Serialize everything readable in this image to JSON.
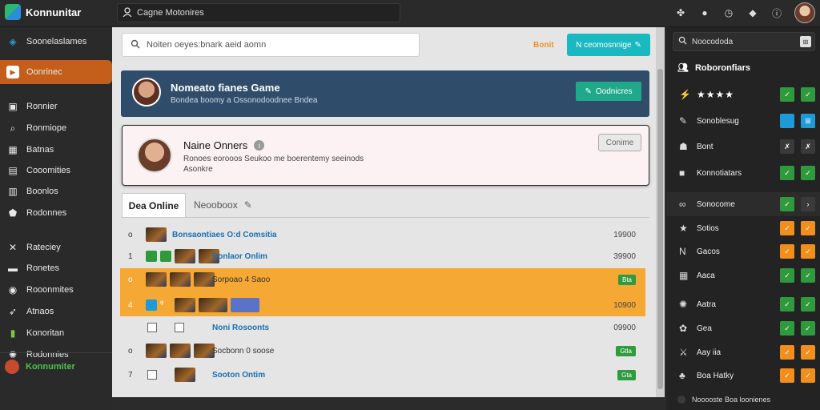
{
  "app": {
    "title": "Konnunitar",
    "search_placeholder": "Cagne Motonires"
  },
  "top_icons": [
    "puzzle-icon",
    "chat-icon",
    "clock-icon",
    "tag-icon",
    "info-icon"
  ],
  "sidebar": {
    "active": {
      "label": "Oonrinec",
      "icon": "play-icon"
    },
    "header": {
      "label": "Soonelaslames",
      "icon": "cube-icon"
    },
    "items": [
      {
        "label": "Ronnier",
        "icon": "briefcase-icon"
      },
      {
        "label": "Ronmiope",
        "icon": "search-icon"
      },
      {
        "label": "Batnas",
        "icon": "calendar-icon"
      },
      {
        "label": "Cooomities",
        "icon": "grid-icon"
      },
      {
        "label": "Boonlos",
        "icon": "bag-icon"
      },
      {
        "label": "Rodonnes",
        "icon": "shield-icon"
      },
      {
        "label": "Rateciey",
        "icon": "tools-icon"
      },
      {
        "label": "Ronetes",
        "icon": "card-icon"
      },
      {
        "label": "Rooonmites",
        "icon": "target-icon"
      },
      {
        "label": "Atnaos",
        "icon": "bird-icon"
      },
      {
        "label": "Konoritan",
        "icon": "flag-icon"
      },
      {
        "label": "Rodonnies",
        "icon": "gear-icon"
      }
    ],
    "footer": {
      "label": "Konnumiter"
    }
  },
  "toolbar": {
    "search_placeholder": "Noiten oeyes:bnark aeid aomn",
    "link_label": "Bonit",
    "button_label": "N ceomosnnige"
  },
  "banner": {
    "title": "Nomeato fianes Game",
    "subtitle": "Bondea boomy a Ossonodoodnee Bndea",
    "button_label": "Oodnicres"
  },
  "profile_card": {
    "name": "Naine Onners",
    "description": "Ronoes eorooos Seukoo me boerentemy seeinods",
    "description_2": "Asonkre",
    "button_label": "Conime"
  },
  "tabs": [
    {
      "label": "Dea Online",
      "active": true
    },
    {
      "label": "Neooboox",
      "active": false
    }
  ],
  "rows": [
    {
      "num": "o",
      "label": "Bonsaontiaes O:d Comsitia",
      "value": "19900"
    },
    {
      "num": "1",
      "label": "Bonlaor Onlim",
      "value": "39900"
    },
    {
      "num": "o",
      "label": "Sorpoao 4 Saoo",
      "pill": "Bta",
      "highlight": true
    },
    {
      "num": "4",
      "label": "",
      "value": "10900",
      "highlight": true
    },
    {
      "num": "",
      "label": "Noni Rosoonts",
      "value": "09900"
    },
    {
      "num": "o",
      "label": "Socbonn 0 soose",
      "pill": "Gtla"
    },
    {
      "num": "7",
      "label": "Sooton Ontim",
      "pill": "Gta"
    }
  ],
  "right_panel": {
    "search_placeholder": "Noocododa",
    "header": "Roboronfiars",
    "rows": [
      {
        "label": "★★★★",
        "icon": "lightning-icon",
        "btn1": "✓",
        "btn2": "✓"
      },
      {
        "label": "Sonoblesug",
        "icon": "pencil-icon",
        "btn1": "",
        "btn2": "⊞"
      },
      {
        "label": "Bont",
        "icon": "users-icon",
        "btn1": "✗",
        "btn2": "✗"
      },
      {
        "label": "Konnotiatars",
        "icon": "square-icon",
        "btn1": "✓",
        "btn2": "✓"
      },
      {
        "label": "Sonocome",
        "icon": "link-icon",
        "btn1": "✓",
        "btn2": "›"
      },
      {
        "label": "Sotios",
        "icon": "star-icon",
        "btn1": "✓",
        "btn2": "✓"
      },
      {
        "label": "Gacos",
        "icon": "n-icon",
        "btn1": "✓",
        "btn2": "✓"
      },
      {
        "label": "Aaca",
        "icon": "grid-icon",
        "btn1": "✓",
        "btn2": "✓"
      },
      {
        "label": "Aatra",
        "icon": "gear-icon",
        "btn1": "✓",
        "btn2": "✓"
      },
      {
        "label": "Gea",
        "icon": "flower-icon",
        "btn1": "✓",
        "btn2": "✓"
      },
      {
        "label": "Aay iia",
        "icon": "sword-icon",
        "btn1": "✓",
        "btn2": "✓"
      },
      {
        "label": "Boa Hatky",
        "icon": "tree-icon",
        "btn1": "✓",
        "btn2": "✓"
      }
    ],
    "footer": "Nooooste Boa loonienes"
  }
}
